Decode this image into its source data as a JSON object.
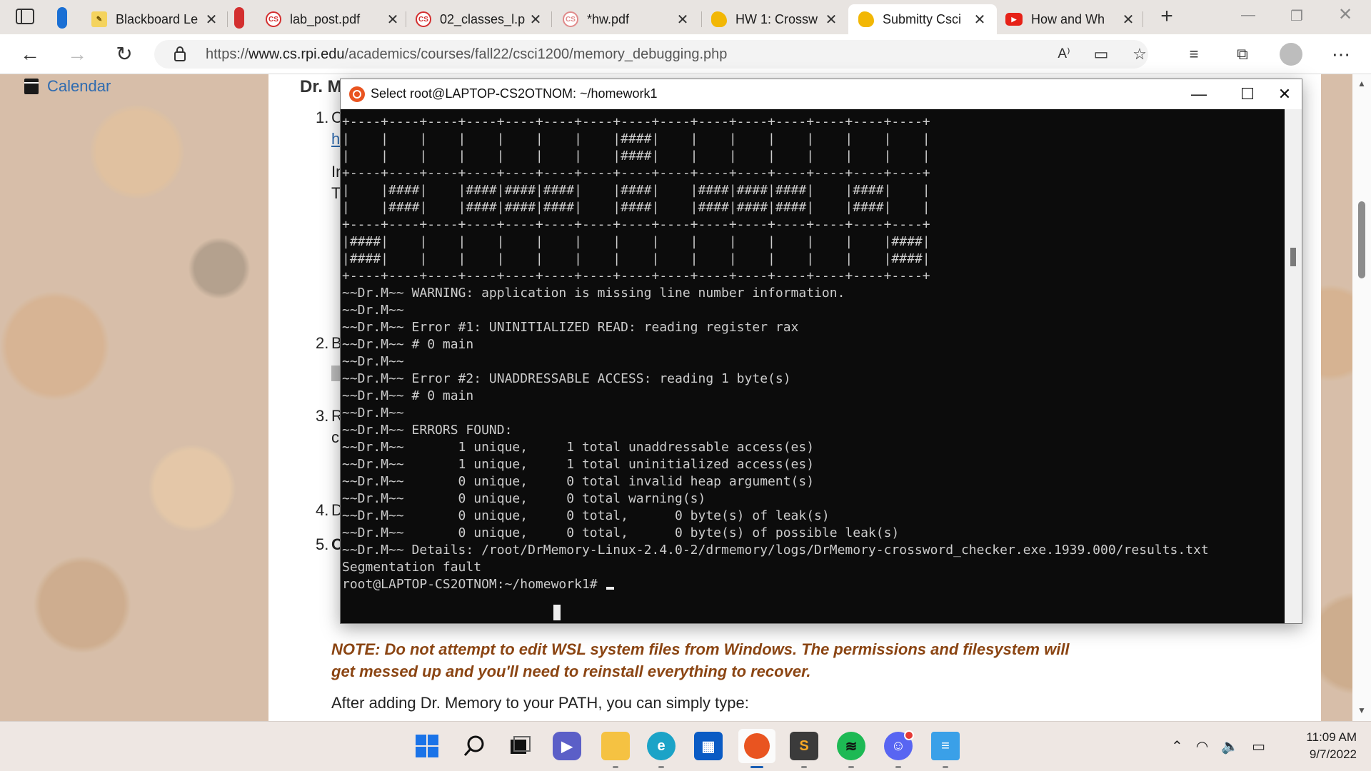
{
  "browser": {
    "tabs": [
      {
        "label": "Blackboard Le",
        "active": false,
        "fav": "blackboard-icon"
      },
      {
        "label": "lab_post.pdf",
        "active": false,
        "fav": "cs-icon"
      },
      {
        "label": "02_classes_l.p",
        "active": false,
        "fav": "cs-icon"
      },
      {
        "label": "*hw.pdf",
        "active": false,
        "fav": "cs-icon"
      },
      {
        "label": "HW 1: Crossw",
        "active": false,
        "fav": "submitty-icon"
      },
      {
        "label": "Submitty Csci",
        "active": true,
        "fav": "submitty-icon"
      },
      {
        "label": "How and Wh",
        "active": false,
        "fav": "youtube-icon"
      }
    ],
    "url_prefix": "https://",
    "url_host": "www.cs.rpi.edu",
    "url_path": "/academics/courses/fall22/csci1200/memory_debugging.php"
  },
  "page": {
    "calendar_label": "Calendar",
    "heading_fragment": "Dr. M",
    "list_numbers": [
      "1.",
      "2.",
      "3.",
      "4.",
      "5."
    ],
    "list_fragments": [
      "C",
      "h",
      "In",
      "T",
      "B",
      "R",
      "c",
      "D",
      "O"
    ],
    "note": "NOTE: Do not attempt to edit WSL system files from Windows. The permissions and filesystem will get messed up and you'll need to reinstall everything to recover.",
    "after_text": "After adding Dr. Memory to your PATH, you can simply type:"
  },
  "terminal": {
    "title": "Select root@LAPTOP-CS2OTNOM: ~/homework1",
    "lines": [
      "+----+----+----+----+----+----+----+----+----+----+----+----+----+----+----+",
      "|    |    |    |    |    |    |    |####|    |    |    |    |    |    |    |",
      "|    |    |    |    |    |    |    |####|    |    |    |    |    |    |    |",
      "+----+----+----+----+----+----+----+----+----+----+----+----+----+----+----+",
      "|    |####|    |####|####|####|    |####|    |####|####|####|    |####|    |",
      "|    |####|    |####|####|####|    |####|    |####|####|####|    |####|    |",
      "+----+----+----+----+----+----+----+----+----+----+----+----+----+----+----+",
      "|####|    |    |    |    |    |    |    |    |    |    |    |    |    |####|",
      "|####|    |    |    |    |    |    |    |    |    |    |    |    |    |####|",
      "+----+----+----+----+----+----+----+----+----+----+----+----+----+----+----+",
      "~~Dr.M~~ WARNING: application is missing line number information.",
      "~~Dr.M~~",
      "~~Dr.M~~ Error #1: UNINITIALIZED READ: reading register rax",
      "~~Dr.M~~ # 0 main",
      "~~Dr.M~~",
      "~~Dr.M~~ Error #2: UNADDRESSABLE ACCESS: reading 1 byte(s)",
      "~~Dr.M~~ # 0 main",
      "~~Dr.M~~",
      "~~Dr.M~~ ERRORS FOUND:",
      "~~Dr.M~~       1 unique,     1 total unaddressable access(es)",
      "~~Dr.M~~       1 unique,     1 total uninitialized access(es)",
      "~~Dr.M~~       0 unique,     0 total invalid heap argument(s)",
      "~~Dr.M~~       0 unique,     0 total warning(s)",
      "~~Dr.M~~       0 unique,     0 total,      0 byte(s) of leak(s)",
      "~~Dr.M~~       0 unique,     0 total,      0 byte(s) of possible leak(s)",
      "~~Dr.M~~ Details: /root/DrMemory-Linux-2.4.0-2/drmemory/logs/DrMemory-crossword_checker.exe.1939.000/results.txt",
      "Segmentation fault",
      "root@LAPTOP-CS2OTNOM:~/homework1# "
    ]
  },
  "taskbar": {
    "apps": [
      "start-icon",
      "search-icon",
      "task-view-icon",
      "teams-chat-icon",
      "file-explorer-icon",
      "edge-icon",
      "store-icon",
      "ubuntu-icon",
      "sublime-text-icon",
      "spotify-icon",
      "discord-icon",
      "notepad-icon"
    ],
    "time": "11:09 AM",
    "date": "9/7/2022"
  },
  "colors": {
    "accent": "#1a5fb4",
    "ubuntu": "#e95420",
    "note": "#8b4513",
    "link": "#2e6bb0"
  }
}
